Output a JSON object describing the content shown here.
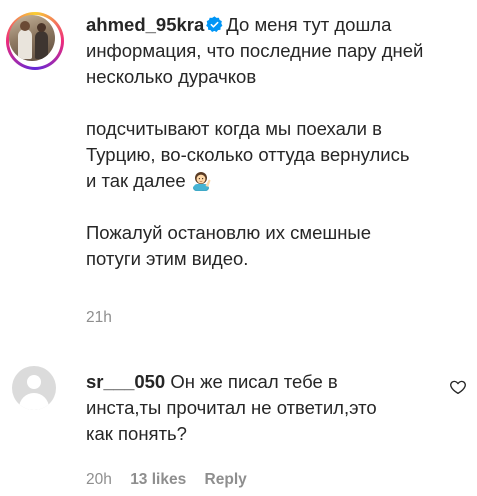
{
  "post": {
    "username": "ahmed_95kra",
    "caption_line1": "До меня тут дошла",
    "caption_lines": [
      "информация, что последние пару дней",
      "несколько дурачков"
    ],
    "para2_lines": [
      "подсчитывают когда мы поехали в",
      "Турцию, во-сколько оттуда вернулись",
      "и так далее"
    ],
    "para3_lines": [
      "Пожалуй остановлю их смешные",
      "потуги этим видео."
    ],
    "time": "21h",
    "icons": {
      "verified": "verified-badge-icon",
      "emoji": "woman-raising-hand-emoji"
    },
    "colors": {
      "verified": "#0095f6",
      "meta": "#8e8e8e"
    }
  },
  "reply": {
    "username": "sr___050",
    "text_first": "Он же писал тебе в",
    "text_lines": [
      "инста,ты прочитал не ответил,это",
      "как понять?"
    ],
    "time": "20h",
    "likes": "13 likes",
    "reply_label": "Reply",
    "icons": {
      "like": "heart-outline-icon"
    }
  }
}
